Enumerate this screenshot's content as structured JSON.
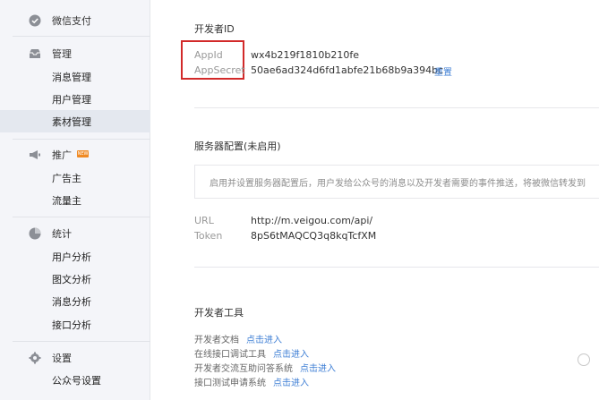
{
  "sidebar": {
    "sections": [
      {
        "label": "微信支付",
        "icon": "wechat-pay-icon",
        "items": []
      },
      {
        "label": "管理",
        "icon": "inbox-icon",
        "items": [
          "消息管理",
          "用户管理",
          "素材管理"
        ],
        "active": "素材管理"
      },
      {
        "label": "推广",
        "icon": "megaphone-icon",
        "badge": "NEW",
        "items": [
          "广告主",
          "流量主"
        ]
      },
      {
        "label": "统计",
        "icon": "pie-chart-icon",
        "items": [
          "用户分析",
          "图文分析",
          "消息分析",
          "接口分析"
        ]
      },
      {
        "label": "设置",
        "icon": "gear-icon",
        "items": [
          "公众号设置"
        ]
      }
    ]
  },
  "main": {
    "dev_id": {
      "title": "开发者ID",
      "appid_label": "AppId",
      "appid_value": "wx4b219f1810b210fe",
      "appsecret_label": "AppSecret",
      "appsecret_value": "50ae6ad324d6fd1abfe21b68b9a394bc",
      "reset_label": "重置"
    },
    "server_config": {
      "title": "服务器配置(未启用)",
      "notice": "启用并设置服务器配置后，用户发给公众号的消息以及开发者需要的事件推送，将被微信转发到",
      "url_label": "URL",
      "url_value": "http://m.veigou.com/api/",
      "token_label": "Token",
      "token_value": "8pS6tMAQCQ3q8kqTcfXM"
    },
    "dev_tools": {
      "title": "开发者工具",
      "rows": [
        {
          "label": "开发者文档",
          "link": "点击进入"
        },
        {
          "label": "在线接口调试工具",
          "link": "点击进入"
        },
        {
          "label": "开发者交流互助问答系统",
          "link": "点击进入"
        },
        {
          "label": "接口测试申请系统",
          "link": "点击进入"
        }
      ]
    }
  },
  "colors": {
    "accent_link": "#3f7fd5",
    "highlight": "#d22a2a",
    "sidebar_bg": "#f4f5f9",
    "badge": "#f08a24"
  }
}
